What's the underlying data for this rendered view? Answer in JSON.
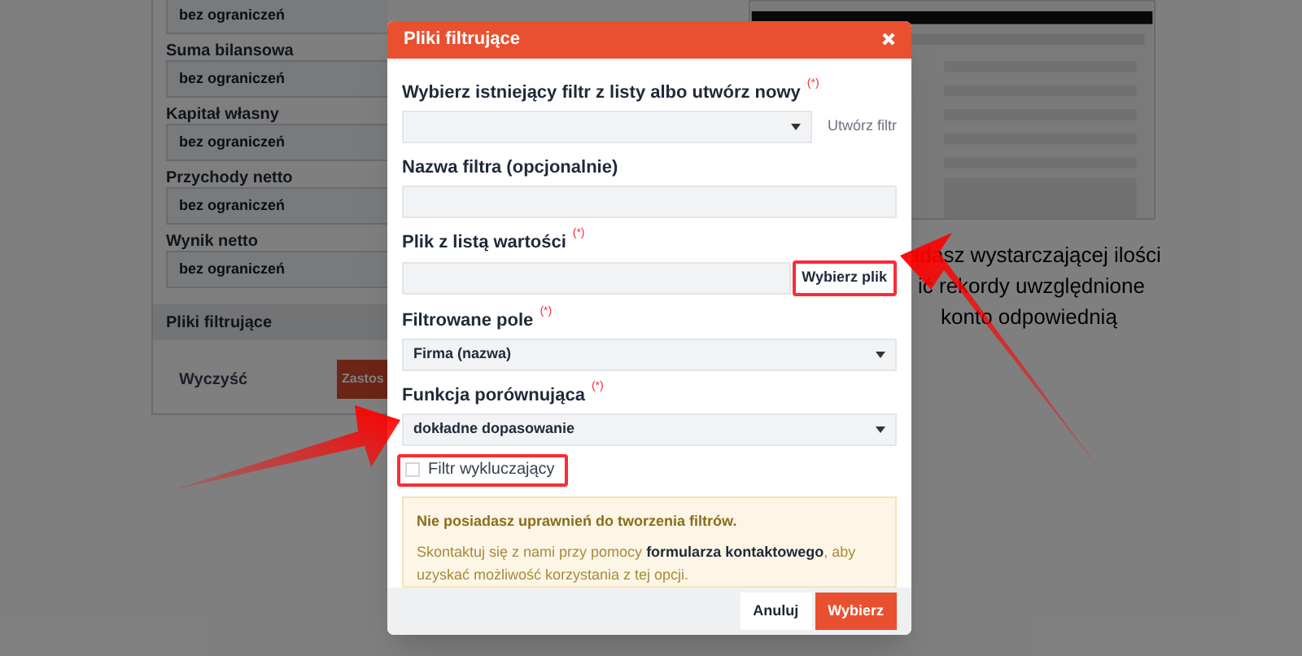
{
  "background_form": {
    "fields": [
      {
        "value": "bez ograniczeń"
      },
      {
        "label": "Suma bilansowa",
        "value": "bez ograniczeń"
      },
      {
        "label": "Kapitał własny",
        "value": "bez ograniczeń"
      },
      {
        "label": "Przychody netto",
        "value": "bez ograniczeń"
      },
      {
        "label": "Wynik netto",
        "value": "bez ograniczeń"
      }
    ],
    "section_title": "Pliki filtrujące",
    "clear_button": "Wyczyść",
    "apply_button": "Zastos"
  },
  "background_text": [
    "adasz wystarczającej ilości",
    "ić rekordy uwzględnione",
    "konto odpowiednią"
  ],
  "dialog": {
    "title": "Pliki filtrujące",
    "fields": [
      {
        "kind": "select",
        "label": "Wybierz istniejący filtr z listy albo utwórz nowy",
        "required_mark": "(*)",
        "side_link": "Utwórz filtr"
      },
      {
        "kind": "text",
        "label": "Nazwa filtra (opcjonalnie)"
      },
      {
        "kind": "file",
        "label": "Plik z listą wartości",
        "required_mark": "(*)",
        "button": "Wybierz plik"
      },
      {
        "kind": "select",
        "label": "Filtrowane pole",
        "required_mark": "(*)",
        "value": "Firma (nazwa)"
      },
      {
        "kind": "select",
        "label": "Funkcja porównująca",
        "required_mark": "(*)",
        "value": "dokładne dopasowanie"
      }
    ],
    "checkbox": {
      "label": "Filtr wykluczający",
      "checked": false
    },
    "alert": {
      "title": "Nie posiadasz uprawnień do tworzenia filtrów.",
      "message": "Skontaktuj się z nami przy pomocy **formularza kontaktowego**, aby uzyskać możliwość korzystania z tej opcji."
    },
    "buttons": [
      {
        "label": "Anuluj",
        "kind": "secondary"
      },
      {
        "label": "Wybierz",
        "kind": "primary"
      }
    ]
  }
}
